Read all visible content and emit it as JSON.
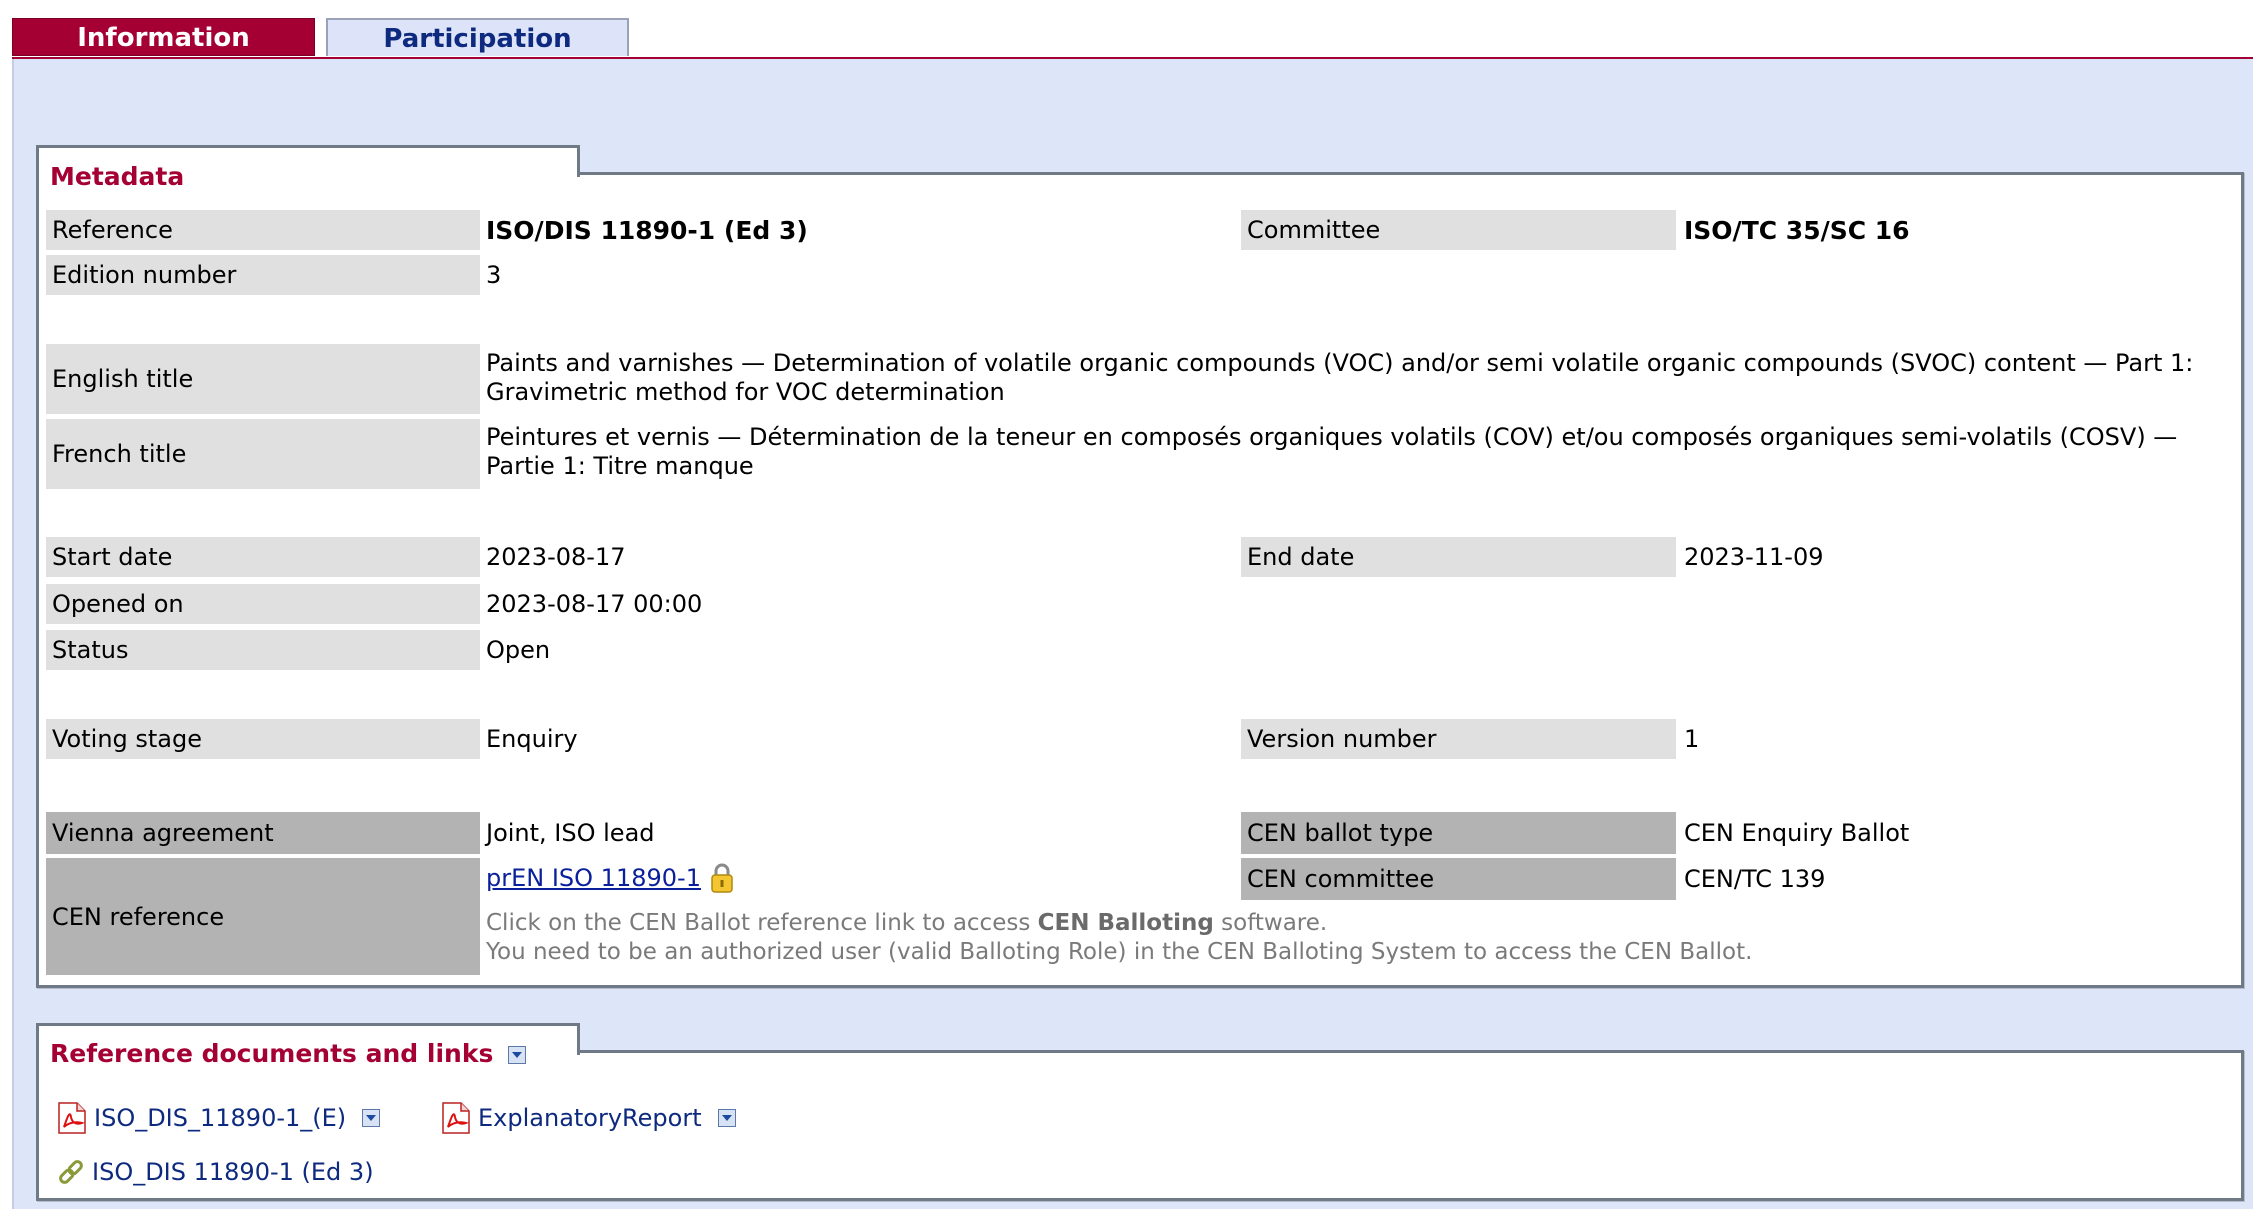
{
  "tabs": {
    "information": "Information",
    "participation": "Participation"
  },
  "metadata": {
    "title": "Metadata",
    "reference": {
      "label": "Reference",
      "value": "ISO/DIS 11890-1 (Ed 3)"
    },
    "committee": {
      "label": "Committee",
      "value": "ISO/TC 35/SC 16"
    },
    "edition_number": {
      "label": "Edition number",
      "value": "3"
    },
    "english_title": {
      "label": "English title",
      "line1": "Paints and varnishes — Determination of volatile organic compounds (VOC) and/or semi volatile organic compounds (SVOC) content — Part 1:",
      "line2": "Gravimetric method for VOC determination"
    },
    "french_title": {
      "label": "French title",
      "line1": "Peintures et vernis — Détermination de la teneur en composés organiques volatils (COV) et/ou composés organiques semi-volatils (COSV) —",
      "line2": "Partie 1: Titre manque"
    },
    "start_date": {
      "label": "Start date",
      "value": "2023-08-17"
    },
    "end_date": {
      "label": "End date",
      "value": "2023-11-09"
    },
    "opened_on": {
      "label": "Opened on",
      "value": "2023-08-17 00:00"
    },
    "status": {
      "label": "Status",
      "value": "Open"
    },
    "voting_stage": {
      "label": "Voting stage",
      "value": "Enquiry"
    },
    "version_number": {
      "label": "Version number",
      "value": "1"
    },
    "vienna_agreement": {
      "label": "Vienna agreement",
      "value": "Joint, ISO lead"
    },
    "cen_ballot_type": {
      "label": "CEN ballot type",
      "value": "CEN Enquiry Ballot"
    },
    "cen_reference": {
      "label": "CEN reference",
      "link": "prEN ISO 11890-1",
      "hint_prefix": "Click on the CEN Ballot reference link to access ",
      "hint_bold": "CEN Balloting",
      "hint_suffix": " software.",
      "hint_line2": "You need to be an authorized user (valid Balloting Role) in the CEN Balloting System to access the CEN Ballot."
    },
    "cen_committee": {
      "label": "CEN committee",
      "value": "CEN/TC 139"
    }
  },
  "reference_documents": {
    "title": "Reference documents and links",
    "documents": [
      "ISO_DIS_11890-1_(E)",
      "ExplanatoryReport"
    ],
    "link": "ISO_DIS 11890-1 (Ed 3)"
  },
  "colors": {
    "accent": "#a50034",
    "panel_bg": "#dde5f9",
    "label_bg": "#e0e0e0",
    "label_dark_bg": "#b3b3b3",
    "link": "#0d2a7f"
  },
  "icons": [
    "pdf-icon",
    "lock-icon",
    "link-icon",
    "dropdown-arrow-icon"
  ]
}
